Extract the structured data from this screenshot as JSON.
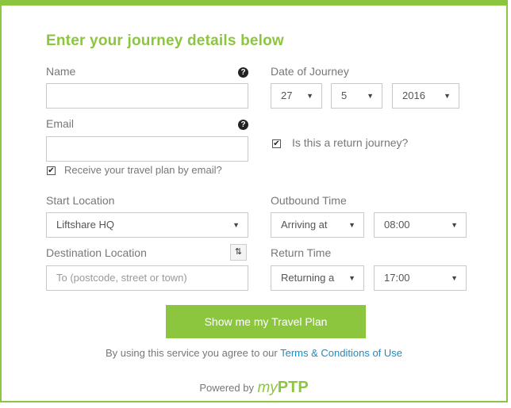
{
  "form": {
    "title": "Enter your journey details below",
    "name_label": "Name",
    "name_value": "",
    "email_label": "Email",
    "email_value": "",
    "email_plan_label": "Receive your travel plan by email?",
    "date_label": "Date of Journey",
    "day": "27",
    "month": "5",
    "year": "2016",
    "return_journey_label": "Is this a return journey?",
    "start_label": "Start Location",
    "start_value": "Liftshare HQ",
    "destination_label": "Destination Location",
    "destination_placeholder": "To (postcode, street or town)",
    "outbound_label": "Outbound Time",
    "outbound_mode": "Arriving at",
    "outbound_time": "08:00",
    "return_label": "Return Time",
    "return_mode": "Returning a",
    "return_time": "17:00",
    "submit_label": "Show me my Travel Plan",
    "terms_prefix": "By using this service you agree to our",
    "terms_link": "Terms & Conditions of Use",
    "powered_by": "Powered by",
    "brand_my": "my",
    "brand_ptp": "PTP"
  },
  "colors": {
    "accent": "#8cc63f",
    "link": "#1e8bc3"
  },
  "icons": {
    "help": "question-circle",
    "swap": "swap-arrows",
    "dropdown": "caret-down",
    "check": "checkmark"
  }
}
